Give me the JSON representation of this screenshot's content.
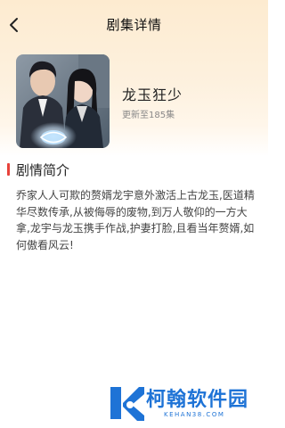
{
  "header": {
    "title": "剧集详情",
    "back_icon": "chevron-left-icon"
  },
  "show": {
    "name": "龙玉狂少",
    "episodes": "更新至185集"
  },
  "synopsis": {
    "heading": "剧情简介",
    "text": "乔家人人可欺的赘婿龙宇意外激活上古龙玉,医道精华尽数传承,从被侮辱的废物,到万人敬仰的一方大拿,龙宇与龙玉携手作战,护妻打脸,且看当年赘婿,如何傲看风云!"
  },
  "watermark": {
    "name": "柯翰软件园",
    "url": "KEHAN38.COM"
  },
  "colors": {
    "header_bg": "#fdebd0",
    "accent": "#e8423b",
    "watermark": "#1e73d6"
  }
}
